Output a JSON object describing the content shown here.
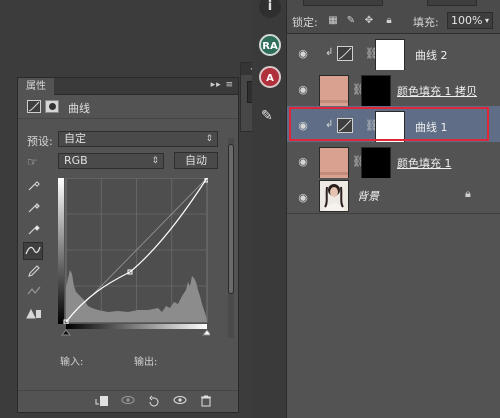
{
  "properties": {
    "tab_label": "属性",
    "tab_controls": "▸▸ ≡",
    "title": "曲线",
    "preset_label": "预设:",
    "preset_value": "自定",
    "channel_value": "RGB",
    "auto_button": "自动",
    "input_label": "输入:",
    "output_label": "输出:",
    "dropdown_arrow": "⇕",
    "select_arrow": "⇕"
  },
  "dock": {
    "top": "◂◂ ✕"
  },
  "layers_panel": {
    "lock_label": "锁定:",
    "fill_label": "填充:",
    "fill_value": "100%",
    "layers": [
      {
        "name": "曲线 2",
        "type": "curves",
        "visible": true,
        "clipped": true
      },
      {
        "name": "颜色填充 1 拷贝",
        "type": "color-fill",
        "visible": true,
        "clipped": false
      },
      {
        "name": "曲线 1",
        "type": "curves",
        "visible": true,
        "clipped": true,
        "selected": true
      },
      {
        "name": "颜色填充 1",
        "type": "color-fill",
        "visible": true,
        "clipped": false
      },
      {
        "name": "背景",
        "type": "background",
        "visible": true,
        "locked": true
      }
    ]
  },
  "right_column": {
    "icons": [
      "info-icon",
      "ra-icon",
      "a-icon",
      "brush-icon"
    ],
    "ra_label": "RA",
    "a_label": "A"
  },
  "colors": {
    "panel_bg": "#535353",
    "dark_bg": "#3c3c3c",
    "selection": "#5f6e86",
    "highlight_frame": "#e0273a",
    "fill_swatch": "#d8a190"
  }
}
